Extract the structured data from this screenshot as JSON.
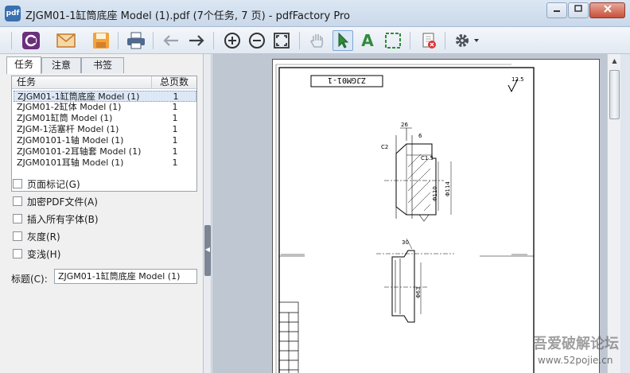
{
  "window": {
    "title": "ZJGM01-1缸筒底座 Model (1).pdf (7个任务, 7 页) - pdfFactory Pro",
    "app_icon": "pdf",
    "min_icon": "minimize-icon",
    "max_icon": "maximize-icon",
    "close_icon": "close-icon"
  },
  "toolbar": {
    "buttons": [
      "pdfFactory-icon",
      "email-icon",
      "save-icon",
      "print-icon",
      "back-arrow-icon",
      "forward-arrow-icon",
      "zoom-in-icon",
      "zoom-out-icon",
      "fit-page-icon",
      "hand-tool-icon",
      "select-arrow-icon",
      "text-tool-icon",
      "snapshot-tool-icon",
      "delete-page-icon",
      "settings-gear-icon"
    ],
    "text_tool_label": "A"
  },
  "sidebar": {
    "tabs": [
      {
        "label": "任务",
        "active": true
      },
      {
        "label": "注意",
        "active": false
      },
      {
        "label": "书签",
        "active": false
      }
    ],
    "jobs_table": {
      "headers": [
        "任务",
        "总页数"
      ],
      "rows": [
        {
          "name": "ZJGM01-1缸筒底座 Model (1)",
          "pages": "1",
          "selected": true
        },
        {
          "name": "ZJGM01-2缸体 Model (1)",
          "pages": "1"
        },
        {
          "name": "ZJGM01缸筒 Model (1)",
          "pages": "1"
        },
        {
          "name": "ZJGM-1活塞杆 Model (1)",
          "pages": "1"
        },
        {
          "name": "ZJGM0101-1轴 Model (1)",
          "pages": "1"
        },
        {
          "name": "ZJGM0101-2耳轴套 Model (1)",
          "pages": "1"
        },
        {
          "name": "ZJGM0101耳轴 Model (1)",
          "pages": "1"
        }
      ]
    },
    "options": [
      {
        "label": "页面标记(G)",
        "checked": false
      },
      {
        "label": "加密PDF文件(A)",
        "checked": false
      },
      {
        "label": "插入所有字体(B)",
        "checked": false
      },
      {
        "label": "灰度(R)",
        "checked": false
      },
      {
        "label": "变浅(H)",
        "checked": false
      }
    ],
    "title_label": "标题(C):",
    "title_value": "ZJGM01-1缸筒底座 Model (1)"
  },
  "drawing": {
    "title_block": "ZJGM01-1",
    "roughness": "12.5",
    "dims": [
      "26",
      "6",
      "C2",
      "C1.5",
      "Φ110",
      "Φ114",
      "30",
      "Φ63"
    ]
  },
  "watermark": {
    "text": "吾爱破解论坛",
    "url": "www.52pojie.cn"
  },
  "colors": {
    "accent": "#3b6fb0",
    "close_red": "#c75039"
  }
}
